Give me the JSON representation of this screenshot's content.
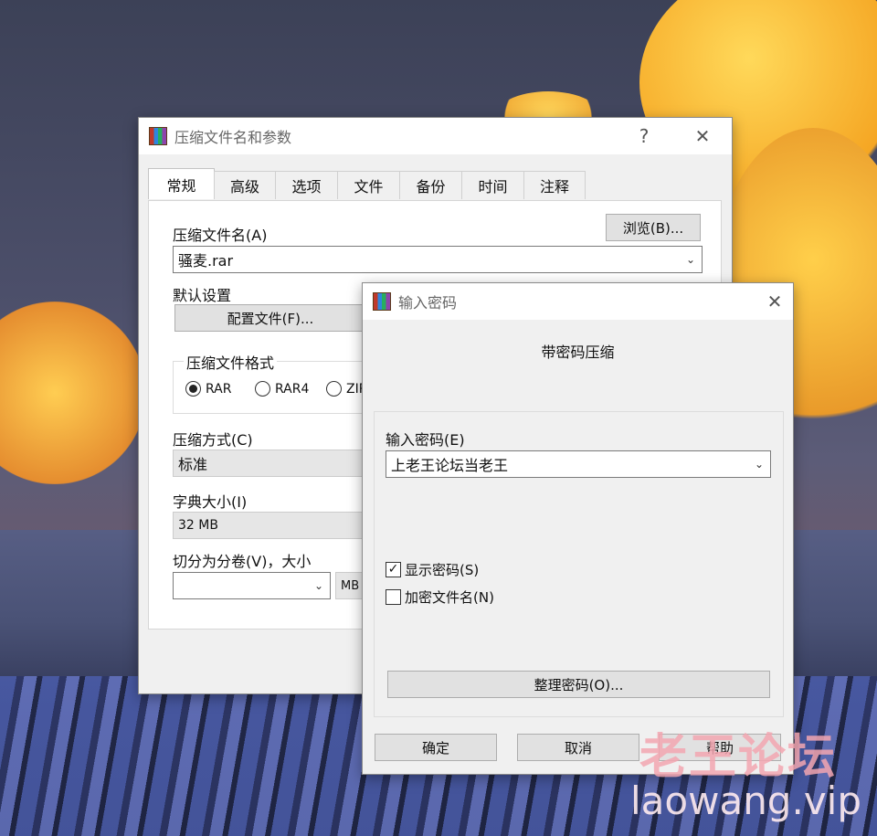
{
  "main_dialog": {
    "title": "压缩文件名和参数",
    "help_glyph": "?",
    "close_glyph": "✕",
    "tabs": [
      {
        "label": "常规",
        "active": true
      },
      {
        "label": "高级"
      },
      {
        "label": "选项"
      },
      {
        "label": "文件"
      },
      {
        "label": "备份"
      },
      {
        "label": "时间"
      },
      {
        "label": "注释"
      }
    ],
    "archive_name_label": "压缩文件名(A)",
    "browse_button": "浏览(B)...",
    "archive_name_value": "骚麦.rar",
    "default_settings_label": "默认设置",
    "profiles_button": "配置文件(F)...",
    "format_group_label": "压缩文件格式",
    "formats": [
      {
        "label": "RAR",
        "selected": true
      },
      {
        "label": "RAR4",
        "selected": false
      },
      {
        "label": "ZIP",
        "selected": false
      }
    ],
    "method_label": "压缩方式(C)",
    "method_value": "标准",
    "dictionary_label": "字典大小(I)",
    "dictionary_value": "32 MB",
    "split_label": "切分为分卷(V)，大小",
    "split_value": "",
    "split_unit": "MB"
  },
  "password_dialog": {
    "title": "输入密码",
    "close_glyph": "✕",
    "heading": "带密码压缩",
    "password_label": "输入密码(E)",
    "password_value": "上老王论坛当老王",
    "show_password_label": "显示密码(S)",
    "show_password_checked": true,
    "encrypt_names_label": "加密文件名(N)",
    "encrypt_names_checked": false,
    "organize_button": "整理密码(O)...",
    "ok_button": "确定",
    "cancel_button": "取消",
    "help_button": "帮助"
  },
  "watermark": {
    "text_cn": "老王论坛",
    "text_url": "laowang.vip",
    "color": "#f2a6b0"
  },
  "icons": {
    "app": "winrar-books-icon",
    "dropdown": "chevron-down-icon",
    "check_mark": "✓"
  }
}
